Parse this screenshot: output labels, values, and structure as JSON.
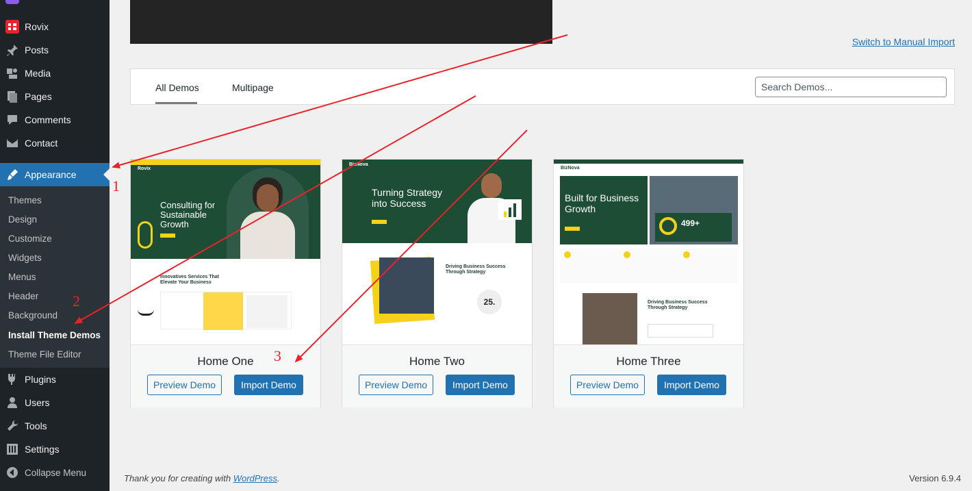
{
  "sidebar": {
    "items": [
      {
        "label": "Rovix",
        "icon": "rovix-logo-icon"
      },
      {
        "label": "Posts",
        "icon": "pin-icon"
      },
      {
        "label": "Media",
        "icon": "media-icon"
      },
      {
        "label": "Pages",
        "icon": "pages-icon"
      },
      {
        "label": "Comments",
        "icon": "comment-icon"
      },
      {
        "label": "Contact",
        "icon": "mail-icon"
      },
      {
        "label": "Appearance",
        "icon": "brush-icon"
      },
      {
        "label": "Plugins",
        "icon": "plugin-icon"
      },
      {
        "label": "Users",
        "icon": "user-icon"
      },
      {
        "label": "Tools",
        "icon": "wrench-icon"
      },
      {
        "label": "Settings",
        "icon": "settings-icon"
      },
      {
        "label": "Collapse Menu",
        "icon": "collapse-icon"
      }
    ],
    "submenu": [
      "Themes",
      "Design",
      "Customize",
      "Widgets",
      "Menus",
      "Header",
      "Background",
      "Install Theme Demos",
      "Theme File Editor"
    ]
  },
  "header": {
    "manual_import_link": "Switch to Manual Import"
  },
  "filter": {
    "tabs": [
      "All Demos",
      "Multipage"
    ],
    "search_placeholder": "Search Demos..."
  },
  "demos": [
    {
      "name": "Home One",
      "preview_label": "Preview Demo",
      "import_label": "Import Demo",
      "thumb": {
        "logo": "Rovix",
        "headline": "Consulting for Sustainable Growth",
        "section": "Innovatives Services That Elevate Your Business"
      }
    },
    {
      "name": "Home Two",
      "preview_label": "Preview Demo",
      "import_label": "Import Demo",
      "thumb": {
        "logo": "BizNova",
        "headline": "Turning Strategy into Success",
        "section": "Driving Business Success Through Strategy",
        "stat": "25."
      }
    },
    {
      "name": "Home Three",
      "preview_label": "Preview Demo",
      "import_label": "Import Demo",
      "thumb": {
        "logo": "BizNova",
        "headline": "Built for Business Growth",
        "stat": "499+",
        "section": "Driving Business Success Through Strategy"
      }
    }
  ],
  "annotations": [
    "1",
    "2",
    "3"
  ],
  "footer": {
    "thanks_prefix": "Thank you for creating with",
    "wp_link": "WordPress",
    "thanks_suffix": ".",
    "version": "Version 6.9.4"
  },
  "colors": {
    "sidebar_bg": "#1d2327",
    "accent": "#2271b1",
    "annotation": "#e8232a",
    "brand_green": "#1d4d35",
    "brand_yellow": "#f4d21a"
  }
}
